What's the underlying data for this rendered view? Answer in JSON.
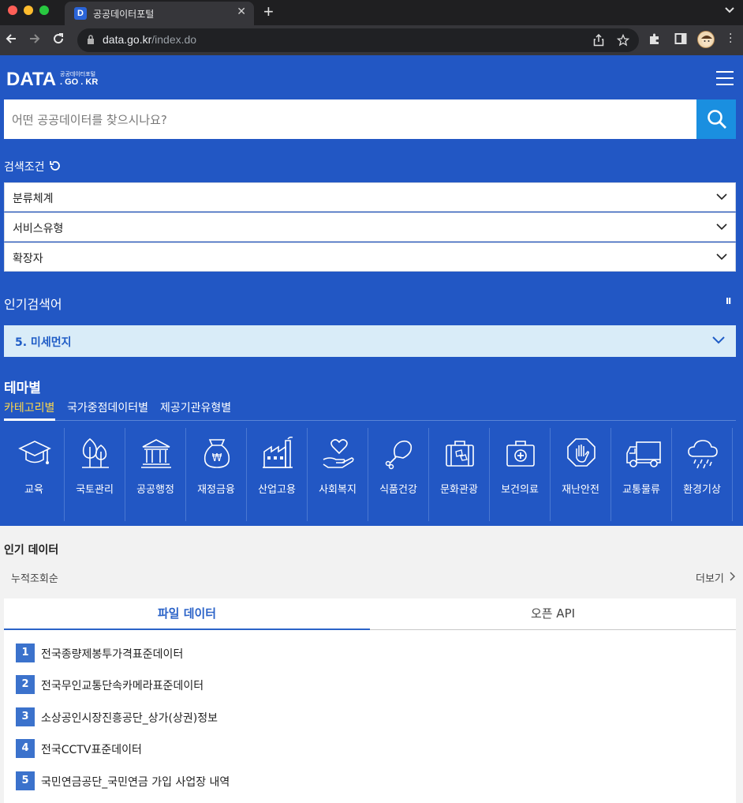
{
  "browser": {
    "tab_title": "공공데이터포털",
    "favicon_letter": "D",
    "url_host": "data.go.kr",
    "url_path": "/index.do"
  },
  "header": {
    "logo_main": "DATA",
    "logo_sub": "공공데이터포털",
    "logo_domain": ". GO . KR"
  },
  "search": {
    "placeholder": "어떤 공공데이터를 찾으시나요?"
  },
  "conditions": {
    "label": "검색조건",
    "selects": [
      "분류체계",
      "서비스유형",
      "확장자"
    ]
  },
  "popular_keywords": {
    "label": "인기검색어",
    "pause": "II",
    "current": "5. 미세먼지"
  },
  "theme": {
    "title": "테마별",
    "tabs": [
      "카테고리별",
      "국가중점데이터별",
      "제공기관유형별"
    ],
    "categories": [
      {
        "label": "교육",
        "icon": "graduation-cap-icon"
      },
      {
        "label": "국토관리",
        "icon": "trees-icon"
      },
      {
        "label": "공공행정",
        "icon": "government-building-icon"
      },
      {
        "label": "재정금융",
        "icon": "money-bag-icon"
      },
      {
        "label": "산업고용",
        "icon": "factory-icon"
      },
      {
        "label": "사회복지",
        "icon": "heart-hand-icon"
      },
      {
        "label": "식품건강",
        "icon": "drumstick-icon"
      },
      {
        "label": "문화관광",
        "icon": "suitcase-icon"
      },
      {
        "label": "보건의료",
        "icon": "first-aid-kit-icon"
      },
      {
        "label": "재난안전",
        "icon": "stop-hand-icon"
      },
      {
        "label": "교통물류",
        "icon": "truck-icon"
      },
      {
        "label": "환경기상",
        "icon": "rain-cloud-icon"
      }
    ]
  },
  "popular_data": {
    "title": "인기 데이터",
    "sort": "누적조회순",
    "more": "더보기",
    "tabs": [
      "파일 데이터",
      "오픈 API"
    ],
    "items": [
      {
        "rank": "1",
        "name": "전국종량제봉투가격표준데이터"
      },
      {
        "rank": "2",
        "name": "전국무인교통단속카메라표준데이터"
      },
      {
        "rank": "3",
        "name": "소상공인시장진흥공단_상가(상권)정보"
      },
      {
        "rank": "4",
        "name": "전국CCTV표준데이터"
      },
      {
        "rank": "5",
        "name": "국민연금공단_국민연금 가입 사업장 내역"
      }
    ]
  },
  "colors": {
    "brand_blue": "#2257c4",
    "search_button": "#1a8fe0",
    "active_tab_yellow": "#ffd84a"
  }
}
